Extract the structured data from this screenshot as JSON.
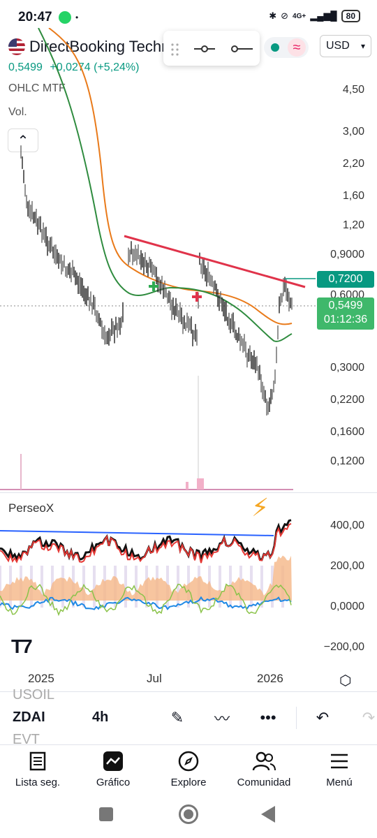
{
  "status_bar": {
    "time": "20:47",
    "net": "4G+",
    "battery": "80"
  },
  "header": {
    "symbol": "DirectBooking Techr",
    "price": "0,5499",
    "change": "+0,0274 (+5,24%)",
    "indicator_1": "OHLC MTF",
    "indicator_2": "Vol.",
    "currency": "USD"
  },
  "price_axis": {
    "ticks": [
      "4,50",
      "3,00",
      "2,20",
      "1,60",
      "1,20",
      "0,9000",
      "0,6000",
      "0,3000",
      "0,2200",
      "0,1600",
      "0,1200"
    ],
    "tag_high": "0,7200",
    "tag_last": "0,5499",
    "tag_timer": "01:12:36"
  },
  "indicator": {
    "name": "PerseoX",
    "ticks": [
      "400,00",
      "200,00",
      "0,0000",
      "−200,00"
    ]
  },
  "time_axis": {
    "labels": [
      "2025",
      "Jul",
      "2026"
    ]
  },
  "bottom_toolbar": {
    "ticker": "ZDAI",
    "interval": "4h",
    "ghost_top": "USOIL",
    "ghost_bottom": "EVT"
  },
  "nav": {
    "items": [
      "Lista seg.",
      "Gráfico",
      "Explore",
      "Comunidad",
      "Menú"
    ]
  },
  "colors": {
    "up": "#089981",
    "down": "#f23645",
    "accent": "#2962ff",
    "trend": "#e0334a"
  }
}
